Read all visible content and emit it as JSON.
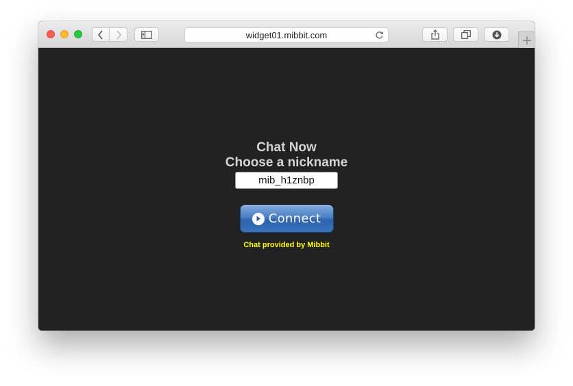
{
  "browser": {
    "url": "widget01.mibbit.com",
    "icons": {
      "back": "chevron-left-icon",
      "forward": "chevron-right-icon",
      "sidebar": "sidebar-icon",
      "reload": "reload-icon",
      "share": "share-icon",
      "tabs": "tabs-overview-icon",
      "download": "download-icon",
      "new_tab": "plus-icon"
    },
    "traffic_lights": [
      "#fc5f57",
      "#fdbc2e",
      "#28c840"
    ]
  },
  "widget": {
    "title_line1": "Chat Now",
    "title_line2": "Choose a nickname",
    "nickname_value": "mib_h1znbp",
    "connect_label": "Connect",
    "provided_text": "Chat provided by Mibbit",
    "colors": {
      "background": "#222222",
      "title": "#d4d4d4",
      "provided": "#ffff00",
      "button": "#3a72bc"
    }
  }
}
